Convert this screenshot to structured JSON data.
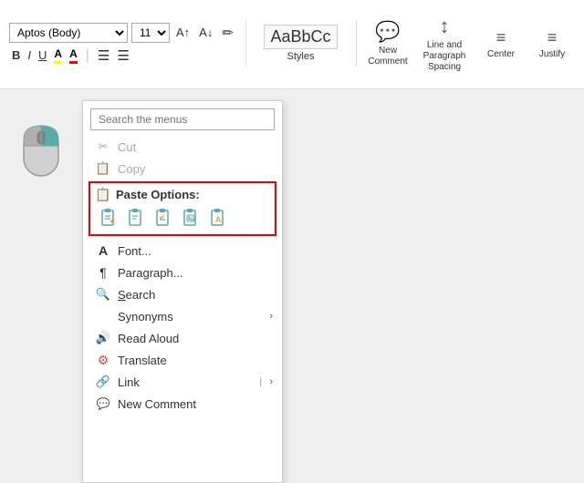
{
  "toolbar": {
    "font_family": "Aptos (Body)",
    "font_size": "11",
    "bold_label": "B",
    "italic_label": "I",
    "underline_label": "U",
    "highlight_label": "A",
    "font_color_label": "A",
    "bullet_list_label": "≡",
    "number_list_label": "≡",
    "styles_label": "Styles",
    "new_comment_label": "New\nComment",
    "line_spacing_label": "Line and\nParagraph Spacing",
    "center_label": "Center",
    "justify_label": "Justify"
  },
  "context_menu": {
    "search_placeholder": "Search the menus",
    "cut_label": "Cut",
    "copy_label": "Copy",
    "paste_options_label": "Paste Options:",
    "font_label": "Font...",
    "paragraph_label": "Paragraph...",
    "search_label": "Search",
    "synonyms_label": "Synonyms",
    "read_aloud_label": "Read Aloud",
    "translate_label": "Translate",
    "link_label": "Link",
    "new_comment_label": "New Comment"
  }
}
